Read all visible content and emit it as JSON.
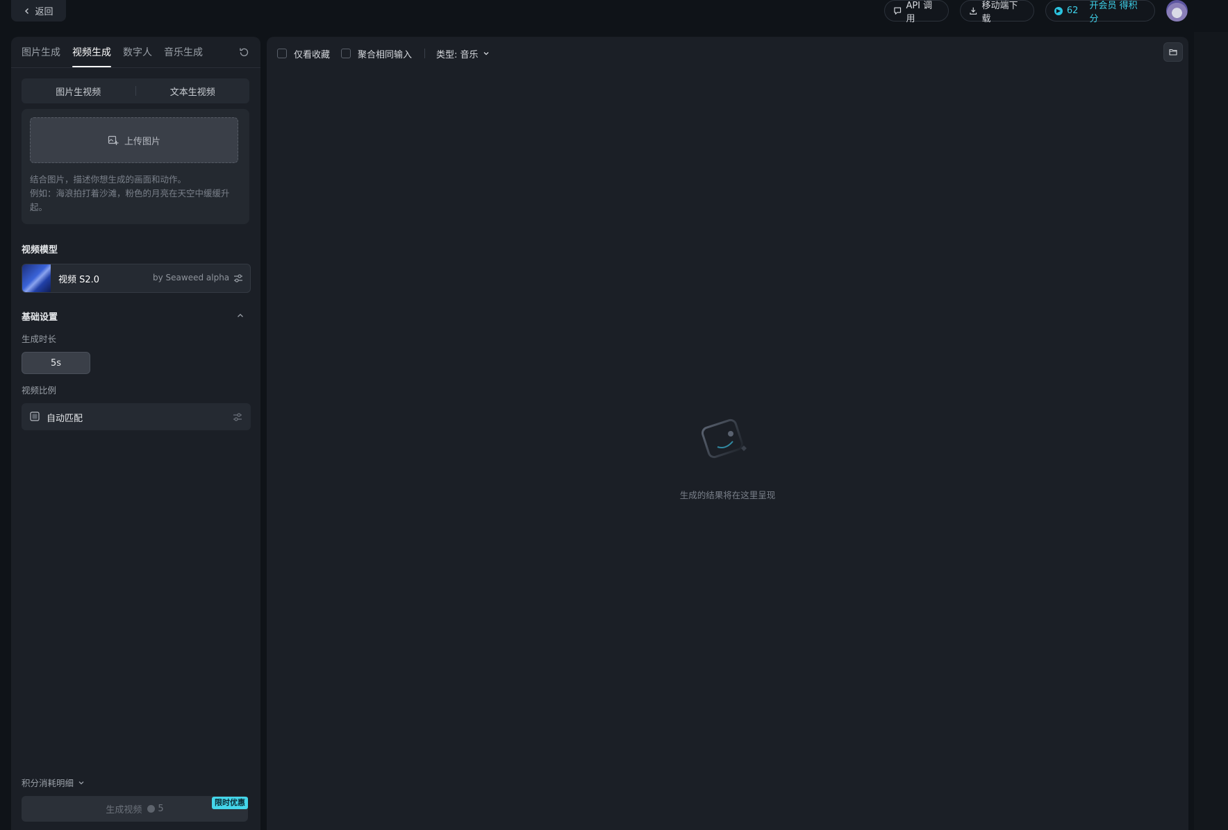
{
  "topbar": {
    "back_label": "返回",
    "api_label": "API 调用",
    "mobile_label": "移动端下载",
    "credits": "62",
    "vip_label": "开会员 得积分"
  },
  "left": {
    "tabs": [
      "图片生成",
      "视频生成",
      "数字人",
      "音乐生成"
    ],
    "active_tab": "视频生成",
    "modes": [
      "图片生视频",
      "文本生视频"
    ],
    "upload_label": "上传图片",
    "prompt_placeholder_line1": "结合图片，描述你想生成的画面和动作。",
    "prompt_placeholder_line2": "例如：海浪拍打着沙滩，粉色的月亮在天空中缓缓升起。",
    "model_section_title": "视频模型",
    "model_name": "视频 S2.0",
    "model_by": "by Seaweed alpha",
    "basic_settings_title": "基础设置",
    "duration_label": "生成时长",
    "duration_value": "5s",
    "ratio_label": "视频比例",
    "ratio_value": "自动匹配",
    "cost_detail_label": "积分消耗明细",
    "generate_label": "生成视频",
    "generate_cost": "5",
    "promo_badge": "限时优惠"
  },
  "right": {
    "filter_favorites": "仅看收藏",
    "filter_aggregate": "聚合相同输入",
    "type_filter": "类型: 音乐",
    "empty_text": "生成的结果将在这里呈现"
  },
  "colors": {
    "accent": "#3ed0e8",
    "panel": "#1b1f26",
    "background": "#0f1318"
  }
}
